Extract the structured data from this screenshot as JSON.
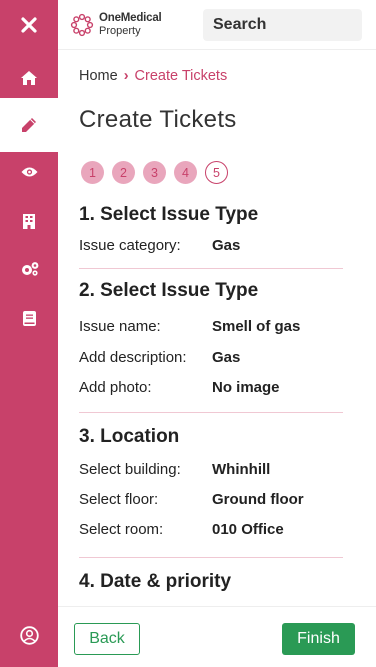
{
  "brand": {
    "line1": "OneMedical",
    "line2": "Property"
  },
  "search": {
    "label": "Search"
  },
  "sidebar": {
    "items": [
      {
        "icon": "close-icon"
      },
      {
        "icon": "home-icon"
      },
      {
        "icon": "pencil-icon",
        "active": true
      },
      {
        "icon": "eye-icon"
      },
      {
        "icon": "building-icon"
      },
      {
        "icon": "cogs-icon"
      },
      {
        "icon": "book-icon"
      },
      {
        "icon": "user-circle-icon"
      }
    ]
  },
  "breadcrumb": {
    "home": "Home",
    "separator": "›",
    "current": "Create Tickets"
  },
  "page": {
    "title": "Create Tickets"
  },
  "steps": [
    {
      "label": "1"
    },
    {
      "label": "2"
    },
    {
      "label": "3"
    },
    {
      "label": "4"
    },
    {
      "label": "5",
      "current": true
    }
  ],
  "sections": {
    "s1": {
      "title": "1. Select Issue Type",
      "rows": [
        {
          "label": "Issue category:",
          "value": "Gas"
        }
      ]
    },
    "s2": {
      "title": "2. Select Issue Type",
      "rows": [
        {
          "label": "Issue name:",
          "value": "Smell of gas"
        },
        {
          "label": "Add description:",
          "value": "Gas"
        },
        {
          "label": "Add photo:",
          "value": "No image"
        }
      ]
    },
    "s3": {
      "title": "3. Location",
      "rows": [
        {
          "label": "Select building:",
          "value": "Whinhill"
        },
        {
          "label": "Select floor:",
          "value": "Ground floor"
        },
        {
          "label": "Select room:",
          "value": "010 Office"
        }
      ]
    },
    "s4": {
      "title": "4. Date & priority"
    }
  },
  "footer": {
    "back": "Back",
    "finish": "Finish"
  },
  "colors": {
    "accent": "#c8416a",
    "green": "#2a9a55",
    "step_fill": "#e9a6bc"
  }
}
